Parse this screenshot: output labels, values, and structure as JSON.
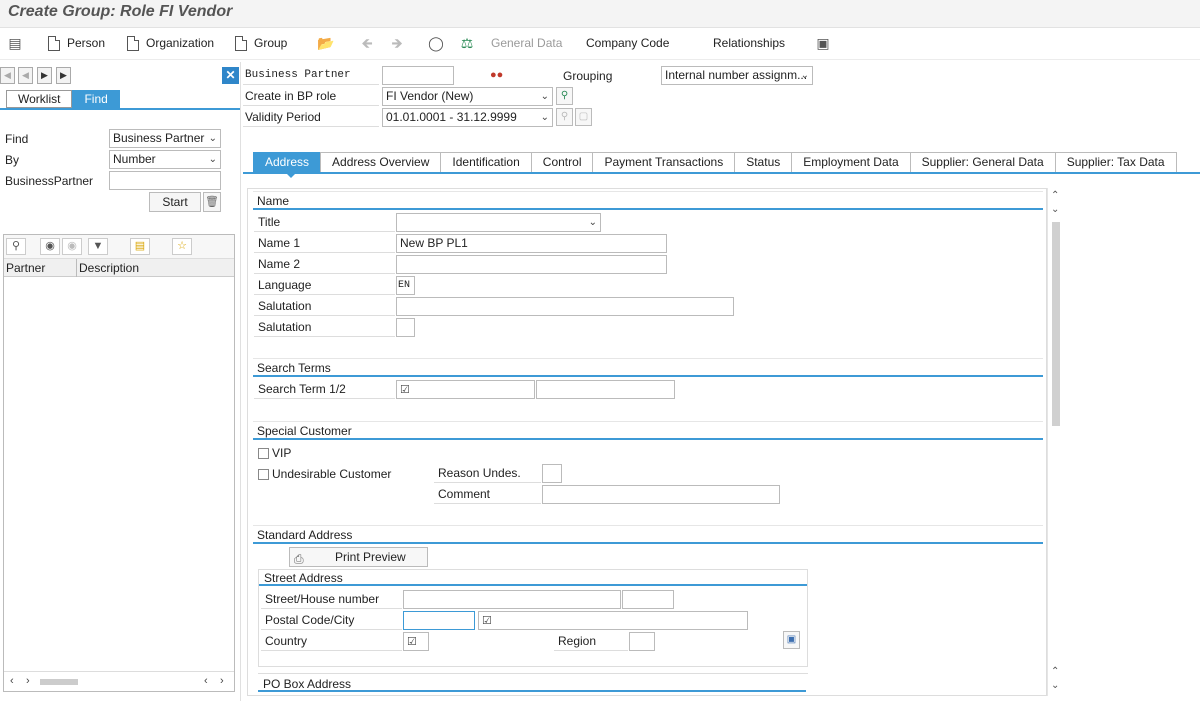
{
  "window": {
    "title": "Create Group: Role FI Vendor"
  },
  "toolbar": {
    "person": "Person",
    "organization": "Organization",
    "group": "Group",
    "general_data": "General Data",
    "company_code": "Company Code",
    "relationships": "Relationships"
  },
  "left": {
    "tabs": {
      "worklist": "Worklist",
      "find": "Find"
    },
    "find_label": "Find",
    "find_value": "Business Partner",
    "by_label": "By",
    "by_value": "Number",
    "bp_label": "BusinessPartner",
    "bp_value": "",
    "start": "Start",
    "list_columns": {
      "partner": "Partner",
      "description": "Description"
    }
  },
  "header": {
    "business_partner_label": "Business Partner",
    "business_partner_value": "",
    "grouping_label": "Grouping",
    "grouping_value": "Internal number assignm...",
    "bp_role_label": "Create in BP role",
    "bp_role_value": "FI Vendor (New)",
    "validity_label": "Validity Period",
    "validity_value": "01.01.0001 - 31.12.9999"
  },
  "tabs": [
    "Address",
    "Address Overview",
    "Identification",
    "Control",
    "Payment Transactions",
    "Status",
    "Employment Data",
    "Supplier: General Data",
    "Supplier: Tax Data"
  ],
  "name_section": {
    "heading": "Name",
    "title_label": "Title",
    "title_value": "",
    "name1_label": "Name 1",
    "name1_value": "New BP PL1",
    "name2_label": "Name 2",
    "name2_value": "",
    "language_label": "Language",
    "language_value": "EN",
    "salutation_label": "Salutation",
    "salutation_value": "",
    "salutation2_label": "Salutation",
    "salutation2_value": ""
  },
  "search_section": {
    "heading": "Search Terms",
    "term_label": "Search Term 1/2",
    "term1_value": "",
    "term2_value": ""
  },
  "special_section": {
    "heading": "Special Customer",
    "vip_label": "VIP",
    "vip_checked": false,
    "undesirable_label": "Undesirable Customer",
    "undesirable_checked": false,
    "reason_label": "Reason Undes.",
    "reason_value": "",
    "comment_label": "Comment",
    "comment_value": ""
  },
  "address_section": {
    "heading": "Standard Address",
    "print_preview": "Print Preview",
    "street_heading": "Street Address",
    "street_label": "Street/House number",
    "street_value": "",
    "house_number_value": "",
    "postal_label": "Postal Code/City",
    "postal_value": "",
    "city_value": "",
    "country_label": "Country",
    "country_value": "",
    "region_label": "Region",
    "region_value": "",
    "pobox_heading": "PO Box Address"
  },
  "colors": {
    "accent": "#3d9ad6",
    "close_button": "#2f86c9"
  }
}
